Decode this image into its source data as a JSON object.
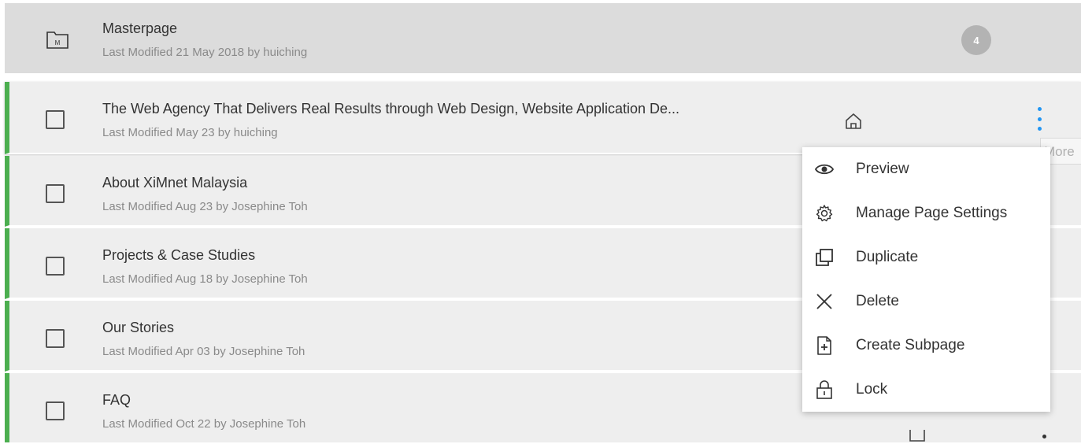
{
  "masterpage": {
    "title": "Masterpage",
    "meta": "Last Modified 21 May 2018 by huiching",
    "count": "4",
    "folder_letter": "M"
  },
  "pages": [
    {
      "title": "The Web Agency That Delivers Real Results through Web Design, Website Application De...",
      "meta": "Last Modified May 23 by huiching"
    },
    {
      "title": "About XiMnet Malaysia",
      "meta": "Last Modified Aug 23 by Josephine Toh"
    },
    {
      "title": "Projects & Case Studies",
      "meta": "Last Modified Aug 18 by Josephine Toh"
    },
    {
      "title": "Our Stories",
      "meta": "Last Modified Apr 03 by Josephine Toh"
    },
    {
      "title": "FAQ",
      "meta": "Last Modified Oct 22 by Josephine Toh"
    }
  ],
  "tooltip": "More",
  "menu": {
    "items": [
      {
        "label": "Preview",
        "icon": "eye-icon"
      },
      {
        "label": "Manage Page Settings",
        "icon": "gear-icon"
      },
      {
        "label": "Duplicate",
        "icon": "duplicate-icon"
      },
      {
        "label": "Delete",
        "icon": "close-icon"
      },
      {
        "label": "Create Subpage",
        "icon": "add-file-icon"
      },
      {
        "label": "Lock",
        "icon": "lock-icon"
      }
    ]
  },
  "colors": {
    "accent_green": "#4caf50",
    "more_blue": "#2196f3",
    "master_bg": "#dcdcdc",
    "row_bg": "#eeeeee"
  }
}
